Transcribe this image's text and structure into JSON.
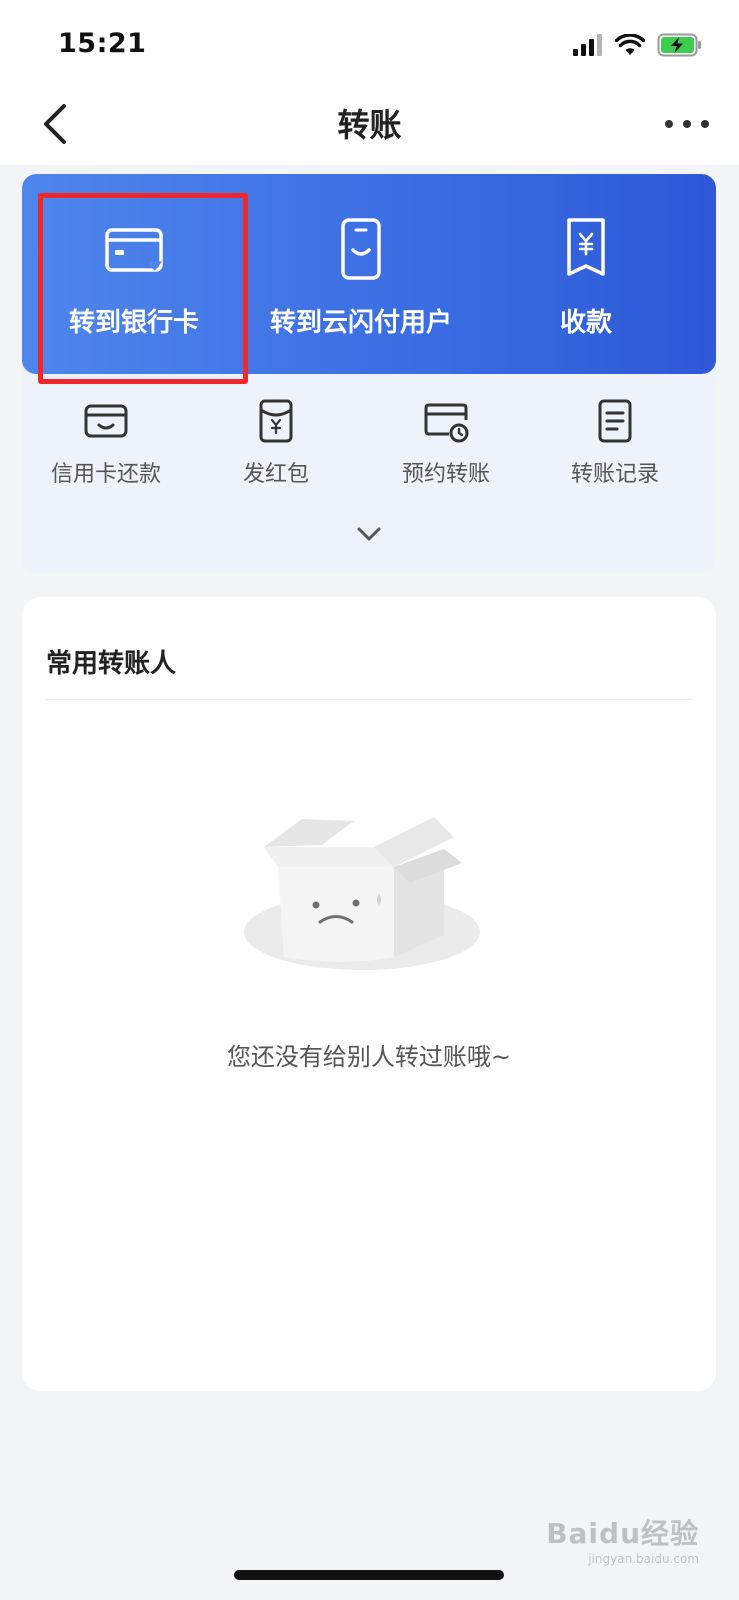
{
  "status_bar": {
    "time": "15:21"
  },
  "nav": {
    "title": "转账"
  },
  "primary_actions": [
    {
      "label": "转到银行卡",
      "icon": "bank-card-icon"
    },
    {
      "label": "转到云闪付用户",
      "icon": "phone-transfer-icon"
    },
    {
      "label": "收款",
      "icon": "receive-money-icon"
    }
  ],
  "secondary_actions": [
    {
      "label": "信用卡还款",
      "icon": "credit-card-icon"
    },
    {
      "label": "发红包",
      "icon": "red-envelope-icon"
    },
    {
      "label": "预约转账",
      "icon": "scheduled-transfer-icon"
    },
    {
      "label": "转账记录",
      "icon": "records-icon"
    }
  ],
  "contacts": {
    "title": "常用转账人",
    "empty_message": "您还没有给别人转过账哦~"
  },
  "watermark": {
    "text": "Baidu经验",
    "sub": "jingyan.baidu.com"
  },
  "colors": {
    "accent": "#3b6ee3",
    "highlight": "#f2262b",
    "background": "#f3f4f6"
  }
}
